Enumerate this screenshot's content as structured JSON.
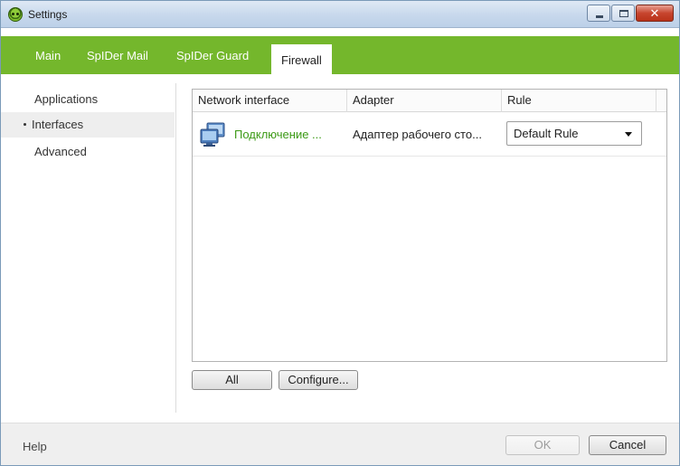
{
  "window": {
    "title": "Settings"
  },
  "tabs": [
    {
      "label": "Main"
    },
    {
      "label": "SpIDer Mail"
    },
    {
      "label": "SpIDer Guard"
    },
    {
      "label": "Firewall",
      "active": true
    }
  ],
  "sidebar": {
    "items": [
      {
        "label": "Applications"
      },
      {
        "label": "Interfaces",
        "selected": true
      },
      {
        "label": "Advanced"
      }
    ]
  },
  "table": {
    "columns": [
      "Network interface",
      "Adapter",
      "Rule"
    ],
    "rows": [
      {
        "interface": "Подключение ...",
        "adapter": "Адаптер рабочего сто...",
        "rule": "Default Rule",
        "icon": "network-connection-icon"
      }
    ]
  },
  "buttons": {
    "all": "All",
    "configure": "Configure..."
  },
  "footer": {
    "help": "Help",
    "ok": "OK",
    "cancel": "Cancel"
  },
  "colors": {
    "accent": "#74b72c",
    "interface_text": "#3c9a16"
  }
}
